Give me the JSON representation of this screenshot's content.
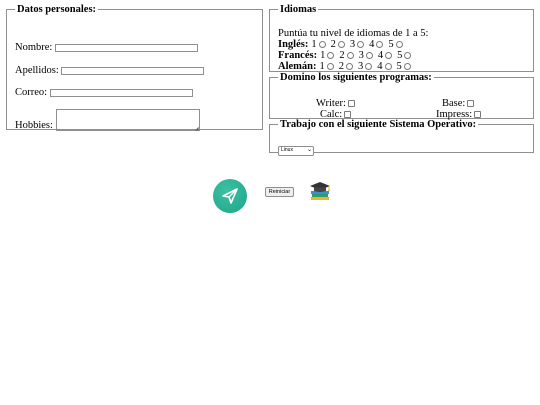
{
  "personal": {
    "legend": "Datos personales:",
    "nombre_label": "Nombre:",
    "apellidos_label": "Apellidos:",
    "correo_label": "Correo:",
    "hobbies_label": "Hobbies:"
  },
  "idiomas": {
    "legend": "Idiomas",
    "instruction": "Puntúa tu nivel de idiomas de 1 a 5:",
    "languages": [
      {
        "name": "Inglés:",
        "levels": [
          "1",
          "2",
          "3",
          "4",
          "5"
        ]
      },
      {
        "name": "Francés:",
        "levels": [
          "1",
          "2",
          "3",
          "4",
          "5"
        ]
      },
      {
        "name": "Alemán:",
        "levels": [
          "1",
          "2",
          "3",
          "4",
          "5"
        ]
      }
    ]
  },
  "programas": {
    "legend": "Domino los siguientes programas:",
    "items": [
      "Writer:",
      "Base:",
      "Calc:",
      "Impress:"
    ]
  },
  "sistema": {
    "legend": "Trabajo con el siguiente Sistema Operativo:",
    "selected": "Linux"
  },
  "actions": {
    "reset_label": "Reiniciar",
    "submit_icon": "send-icon",
    "graduation_icon": "graduation-cap-books-icon",
    "colors": {
      "submit_circle": "#1fa58a",
      "submit_circle_light": "#3cc0a3"
    }
  }
}
